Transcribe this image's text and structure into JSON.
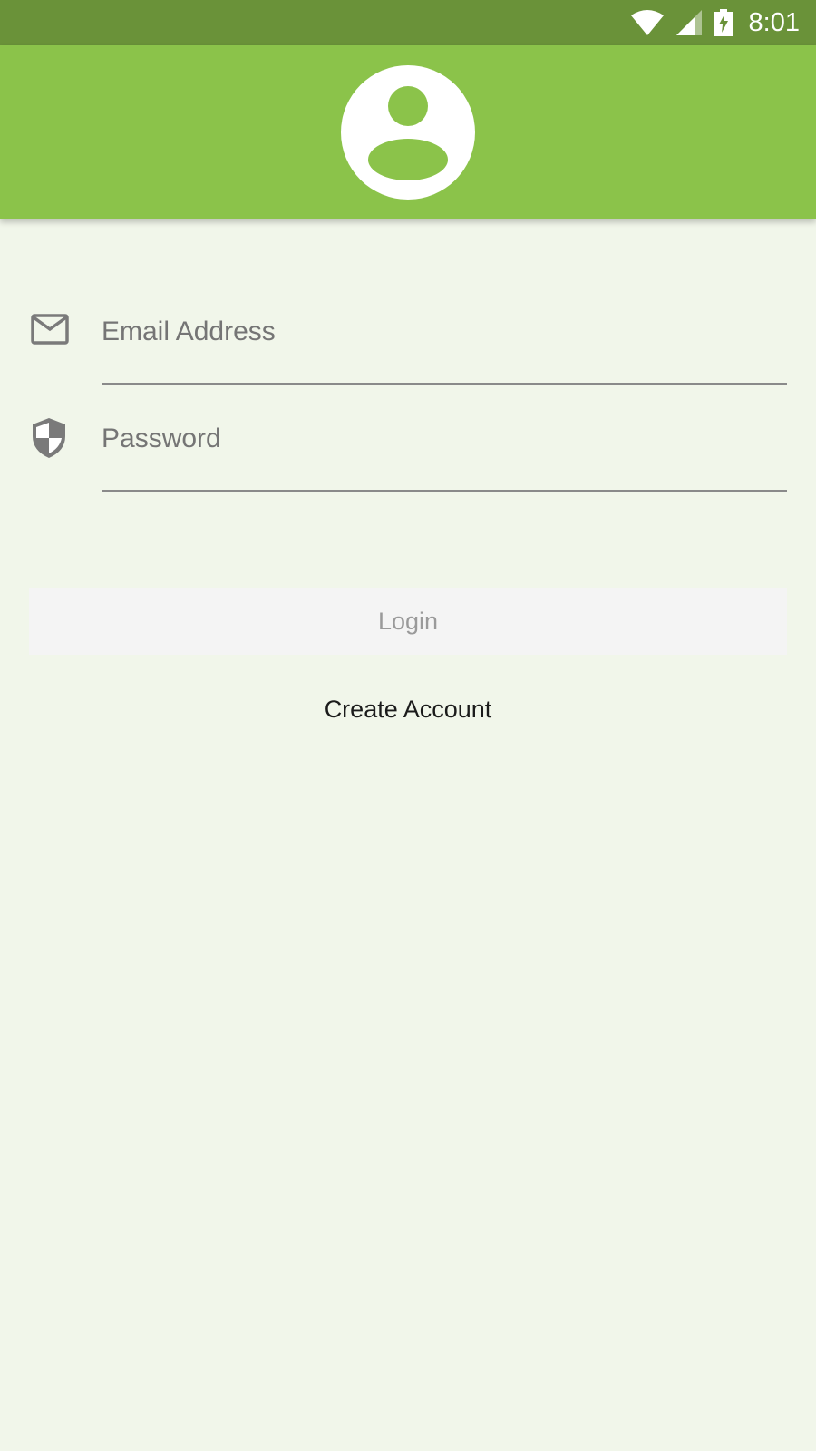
{
  "status_bar": {
    "time": "8:01",
    "icons": [
      "wifi-icon",
      "cell-signal-icon",
      "battery-charging-icon"
    ],
    "background": "#6a9239"
  },
  "header": {
    "background": "#8bc34a",
    "icon": "account-circle-icon"
  },
  "form": {
    "email": {
      "placeholder": "Email Address",
      "value": "",
      "icon": "email-icon"
    },
    "password": {
      "placeholder": "Password",
      "value": "",
      "icon": "shield-icon"
    }
  },
  "actions": {
    "login_label": "Login",
    "create_account_label": "Create Account"
  },
  "colors": {
    "page_background": "#f1f6ea",
    "accent": "#8bc34a"
  }
}
